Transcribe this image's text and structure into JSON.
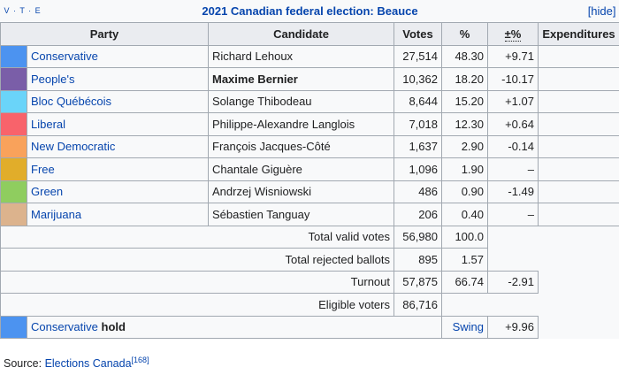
{
  "caption": {
    "vte": "V · T · E",
    "title": "2021 Canadian federal election: Beauce",
    "hide": "[hide]"
  },
  "headers": {
    "party": "Party",
    "candidate": "Candidate",
    "votes": "Votes",
    "pct": "%",
    "change": "±%",
    "expenditures": "Expenditures"
  },
  "rows": [
    {
      "color": "#4c93f0",
      "party": "Conservative",
      "candidate": "Richard Lehoux",
      "votes": "27,514",
      "pct": "48.30",
      "change": "+9.71",
      "expenditures": ""
    },
    {
      "color": "#7a5ea8",
      "party": "People's",
      "candidate": "Maxime Bernier",
      "votes": "10,362",
      "pct": "18.20",
      "change": "-10.17",
      "expenditures": ""
    },
    {
      "color": "#6ad4f9",
      "party": "Bloc Québécois",
      "candidate": "Solange Thibodeau",
      "votes": "8,644",
      "pct": "15.20",
      "change": "+1.07",
      "expenditures": ""
    },
    {
      "color": "#f8636b",
      "party": "Liberal",
      "candidate": "Philippe-Alexandre Langlois",
      "votes": "7,018",
      "pct": "12.30",
      "change": "+0.64",
      "expenditures": ""
    },
    {
      "color": "#f9a25b",
      "party": "New Democratic",
      "candidate": "François Jacques-Côté",
      "votes": "1,637",
      "pct": "2.90",
      "change": "-0.14",
      "expenditures": ""
    },
    {
      "color": "#e1ad2a",
      "party": "Free",
      "candidate": "Chantale Giguère",
      "votes": "1,096",
      "pct": "1.90",
      "change": "–",
      "expenditures": ""
    },
    {
      "color": "#8fcd5f",
      "party": "Green",
      "candidate": "Andrzej Wisniowski",
      "votes": "486",
      "pct": "0.90",
      "change": "-1.49",
      "expenditures": ""
    },
    {
      "color": "#dcb38d",
      "party": "Marijuana",
      "candidate": "Sébastien Tanguay",
      "votes": "206",
      "pct": "0.40",
      "change": "–",
      "expenditures": ""
    }
  ],
  "totals": {
    "valid": {
      "label": "Total valid votes",
      "votes": "56,980",
      "pct": "100.0"
    },
    "rejected": {
      "label": "Total rejected ballots",
      "votes": "895",
      "pct": "1.57"
    },
    "turnout": {
      "label": "Turnout",
      "votes": "57,875",
      "pct": "66.74",
      "change": "-2.91"
    },
    "eligible": {
      "label": "Eligible voters",
      "votes": "86,716"
    }
  },
  "hold": {
    "color": "#4c93f0",
    "party": "Conservative",
    "suffix": "hold",
    "swing_label": "Swing",
    "swing": "+9.96"
  },
  "source": {
    "prefix": "Source: ",
    "link": "Elections Canada",
    "ref": "[168]"
  }
}
